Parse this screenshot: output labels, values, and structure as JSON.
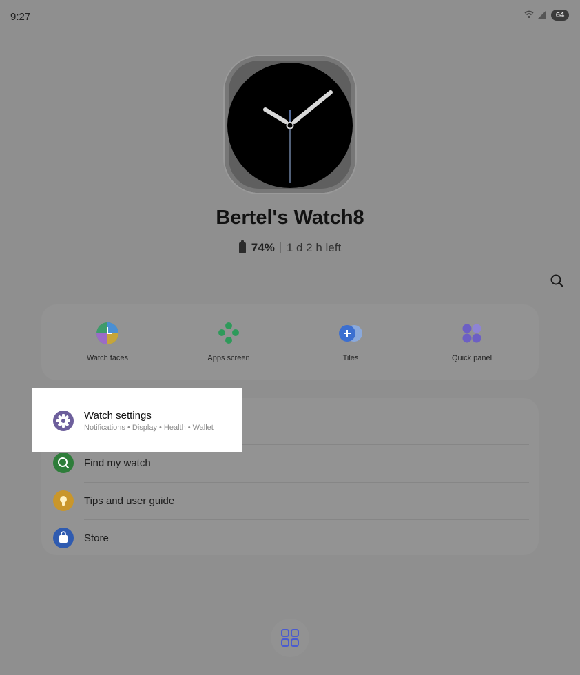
{
  "status_bar": {
    "time": "9:27",
    "battery_level": "64",
    "wifi_icon": "wifi-icon",
    "signal_icon": "signal-icon"
  },
  "watch": {
    "name": "Bertel's Watch8",
    "battery_percent": "74%",
    "time_left": "1 d 2 h left"
  },
  "quick_actions": [
    {
      "label": "Watch faces",
      "icon": "watch-faces-icon"
    },
    {
      "label": "Apps screen",
      "icon": "apps-screen-icon"
    },
    {
      "label": "Tiles",
      "icon": "tiles-icon"
    },
    {
      "label": "Quick panel",
      "icon": "quick-panel-icon"
    }
  ],
  "menu": {
    "watch_settings": {
      "title": "Watch settings",
      "subtitle": "Notifications • Display • Health • Wallet"
    },
    "items": [
      {
        "label": "Find my watch",
        "icon": "find-my-watch-icon"
      },
      {
        "label": "Tips and user guide",
        "icon": "lightbulb-icon"
      },
      {
        "label": "Store",
        "icon": "store-bag-icon"
      }
    ]
  },
  "colors": {
    "background": "#8f8f8f",
    "card": "#939393",
    "highlight": "#ffffff",
    "settings_icon": "#6d5f9c",
    "find_icon": "#2e7d3a",
    "tips_icon": "#c9962a",
    "store_icon": "#2f5bb0"
  }
}
